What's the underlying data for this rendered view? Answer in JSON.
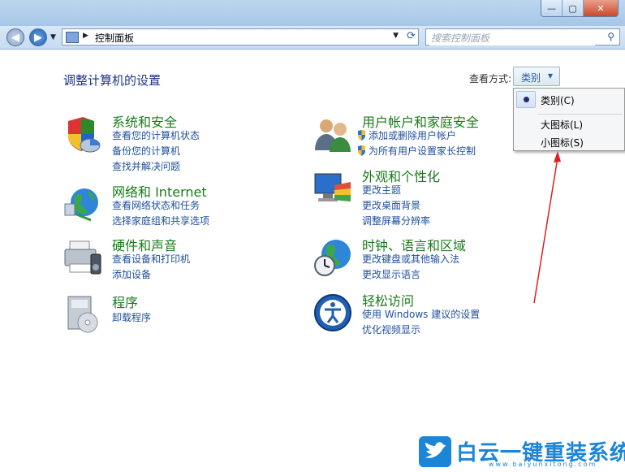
{
  "window": {
    "minimize_label": "—",
    "maximize_label": "▢",
    "close_label": "✕"
  },
  "nav": {
    "back_label": "◀",
    "forward_label": "▶",
    "breadcrumb_sep": "▶",
    "address": "控制面板",
    "search_placeholder": "搜索控制面板"
  },
  "page": {
    "heading": "调整计算机的设置",
    "view_by_label": "查看方式:",
    "view_by_value": "类别"
  },
  "categories": [
    {
      "title": "系统和安全",
      "icon": "system-security-icon",
      "links": [
        "查看您的计算机状态",
        "备份您的计算机",
        "查找并解决问题"
      ]
    },
    {
      "title": "网络和 Internet",
      "icon": "network-icon",
      "links": [
        "查看网络状态和任务",
        "选择家庭组和共享选项"
      ]
    },
    {
      "title": "硬件和声音",
      "icon": "hardware-sound-icon",
      "links": [
        "查看设备和打印机",
        "添加设备"
      ]
    },
    {
      "title": "程序",
      "icon": "programs-icon",
      "links": [
        "卸载程序"
      ]
    },
    {
      "title": "用户帐户和家庭安全",
      "icon": "user-accounts-icon",
      "links": [
        "添加或删除用户帐户",
        "为所有用户设置家长控制"
      ]
    },
    {
      "title": "外观和个性化",
      "icon": "appearance-icon",
      "links": [
        "更改主题",
        "更改桌面背景",
        "调整屏幕分辨率"
      ]
    },
    {
      "title": "时钟、语言和区域",
      "icon": "clock-language-icon",
      "links": [
        "更改键盘或其他输入法",
        "更改显示语言"
      ]
    },
    {
      "title": "轻松访问",
      "icon": "ease-of-access-icon",
      "links": [
        "使用 Windows 建议的设置",
        "优化视频显示"
      ]
    }
  ],
  "menu": {
    "items": [
      "类别(C)",
      "大图标(L)",
      "小图标(S)"
    ],
    "selected": 0
  },
  "watermark": {
    "title": "白云一键重装系统",
    "url": "www.baiyunxitong.com"
  },
  "colors": {
    "heading": "#1e3287",
    "category_title": "#1a7a1a",
    "link": "#1f4f9d",
    "annotation_arrow": "#e02020",
    "watermark": "#1b85d8"
  }
}
